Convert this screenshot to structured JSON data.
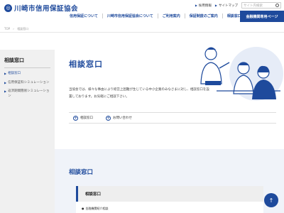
{
  "header": {
    "logo_text": "川崎市信用保証協会",
    "utility": [
      {
        "label": "採用情報"
      },
      {
        "label": "サイトマップ"
      }
    ],
    "search_placeholder": "サイト内検索",
    "nav": [
      "信用保証について",
      "川崎市信用保証協会について",
      "ご利用案内",
      "保証制度のご案内",
      "相談窓口"
    ],
    "member_button": "金融機関専用ページ"
  },
  "breadcrumb": [
    "TOP",
    "相談窓口"
  ],
  "sidebar": {
    "title": "相談窓口",
    "items": [
      {
        "label": "相談窓口",
        "active": true
      },
      {
        "label": "信用保証料シミュレーション",
        "active": false
      },
      {
        "label": "返済期間簡易シミュレーション",
        "active": false
      }
    ]
  },
  "main": {
    "title": "相談窓口",
    "intro": "当協会では、様々な事由により経営上困難が生じている中小企業のみなさまに対し、相談窓口を設置しております。お気軽にご相談下さい。",
    "jump_links": [
      "相談窓口",
      "お問い合わせ"
    ],
    "section_title": "相談窓口",
    "box_title": "相談窓口",
    "box_item": "金融機関紹介相談"
  },
  "colors": {
    "brand": "#1e4a9c"
  },
  "icons": [
    "logo-icon",
    "search-icon",
    "plus-circle-icon",
    "arrow-up-icon"
  ]
}
